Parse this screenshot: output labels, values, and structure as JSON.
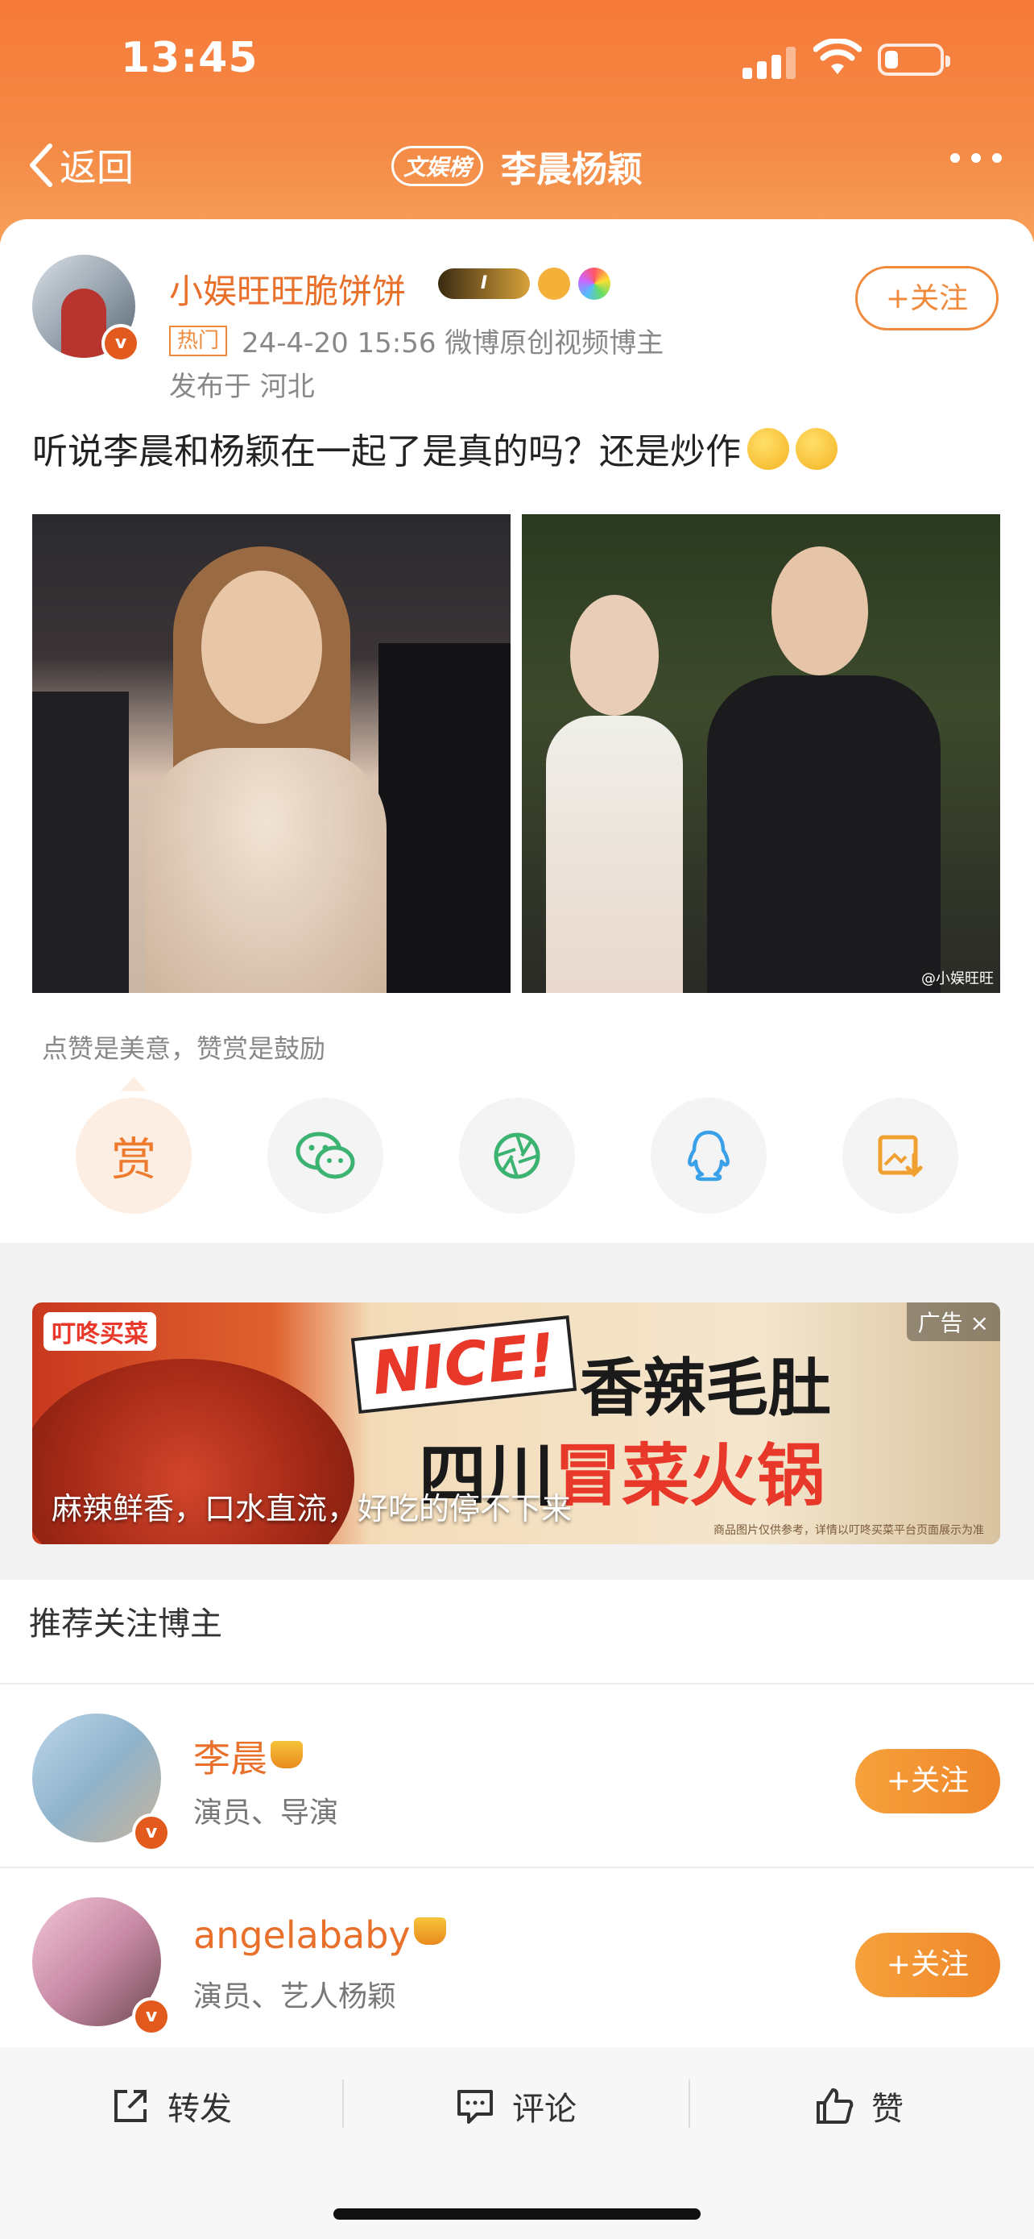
{
  "status_bar": {
    "time": "13:45"
  },
  "nav": {
    "back_label": "返回",
    "tag": "文娱榜",
    "title": "李晨杨颖"
  },
  "post": {
    "author": "小娱旺旺脆饼饼",
    "level": "I",
    "hot_tag": "热门",
    "meta": "24-4-20 15:56 微博原创视频博主",
    "location": "发布于 河北",
    "follow_label": "+关注",
    "text": "听说李晨和杨颖在一起了是真的吗？还是炒作",
    "watermark": "@小娱旺旺"
  },
  "reward": {
    "tip": "点赞是美意，赞赏是鼓励",
    "reward_label": "赏"
  },
  "ad": {
    "brand": "叮咚买菜",
    "nice": "NICE!",
    "line1": "香辣毛肚",
    "line2_a": "四川",
    "line2_b": "冒菜火锅",
    "caption": "麻辣鲜香，口水直流，好吃的停不下来",
    "label": "广告 ×",
    "fine": "商品图片仅供参考，详情以叮咚买菜平台页面展示为准"
  },
  "recommend": {
    "title": "推荐关注博主",
    "items": [
      {
        "name": "李晨",
        "desc": "演员、导演",
        "follow": "+关注"
      },
      {
        "name": "angelababy",
        "desc": "演员、艺人杨颖",
        "follow": "+关注"
      }
    ]
  },
  "toolbar": {
    "repost": "转发",
    "comment": "评论",
    "like": "赞"
  },
  "colors": {
    "accent": "#f08a3c",
    "header": "#f77a3a"
  }
}
